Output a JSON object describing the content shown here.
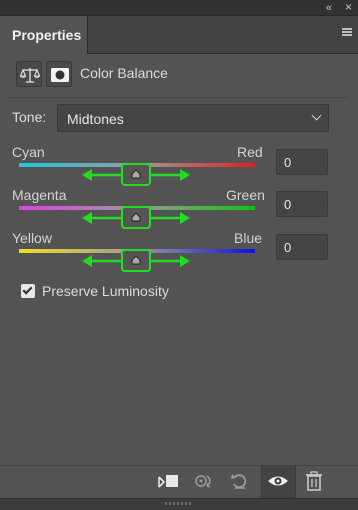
{
  "window": {
    "collapse_glyph": "«",
    "close_glyph": "×"
  },
  "panel": {
    "tab_label": "Properties",
    "menu_icon": "hamburger-menu-icon"
  },
  "header": {
    "adjustment_icon": "balance-scale-icon",
    "mask_icon": "layer-mask-icon",
    "title": "Color Balance"
  },
  "tone": {
    "label": "Tone:",
    "selected": "Midtones"
  },
  "sliders": [
    {
      "left_label": "Cyan",
      "right_label": "Red",
      "value": "0",
      "left_color": "#1ec8e6",
      "right_color": "#e02020"
    },
    {
      "left_label": "Magenta",
      "right_label": "Green",
      "value": "0",
      "left_color": "#e040e0",
      "right_color": "#10c010"
    },
    {
      "left_label": "Yellow",
      "right_label": "Blue",
      "value": "0",
      "left_color": "#f0e020",
      "right_color": "#1010e0"
    }
  ],
  "preserve_luminosity": {
    "label": "Preserve Luminosity",
    "checked": true
  },
  "annotation_color": "#22dd22",
  "bottom_icons": [
    "clip-to-layer-icon",
    "view-previous-state-icon",
    "reset-icon",
    "visibility-eye-icon",
    "trash-icon"
  ]
}
